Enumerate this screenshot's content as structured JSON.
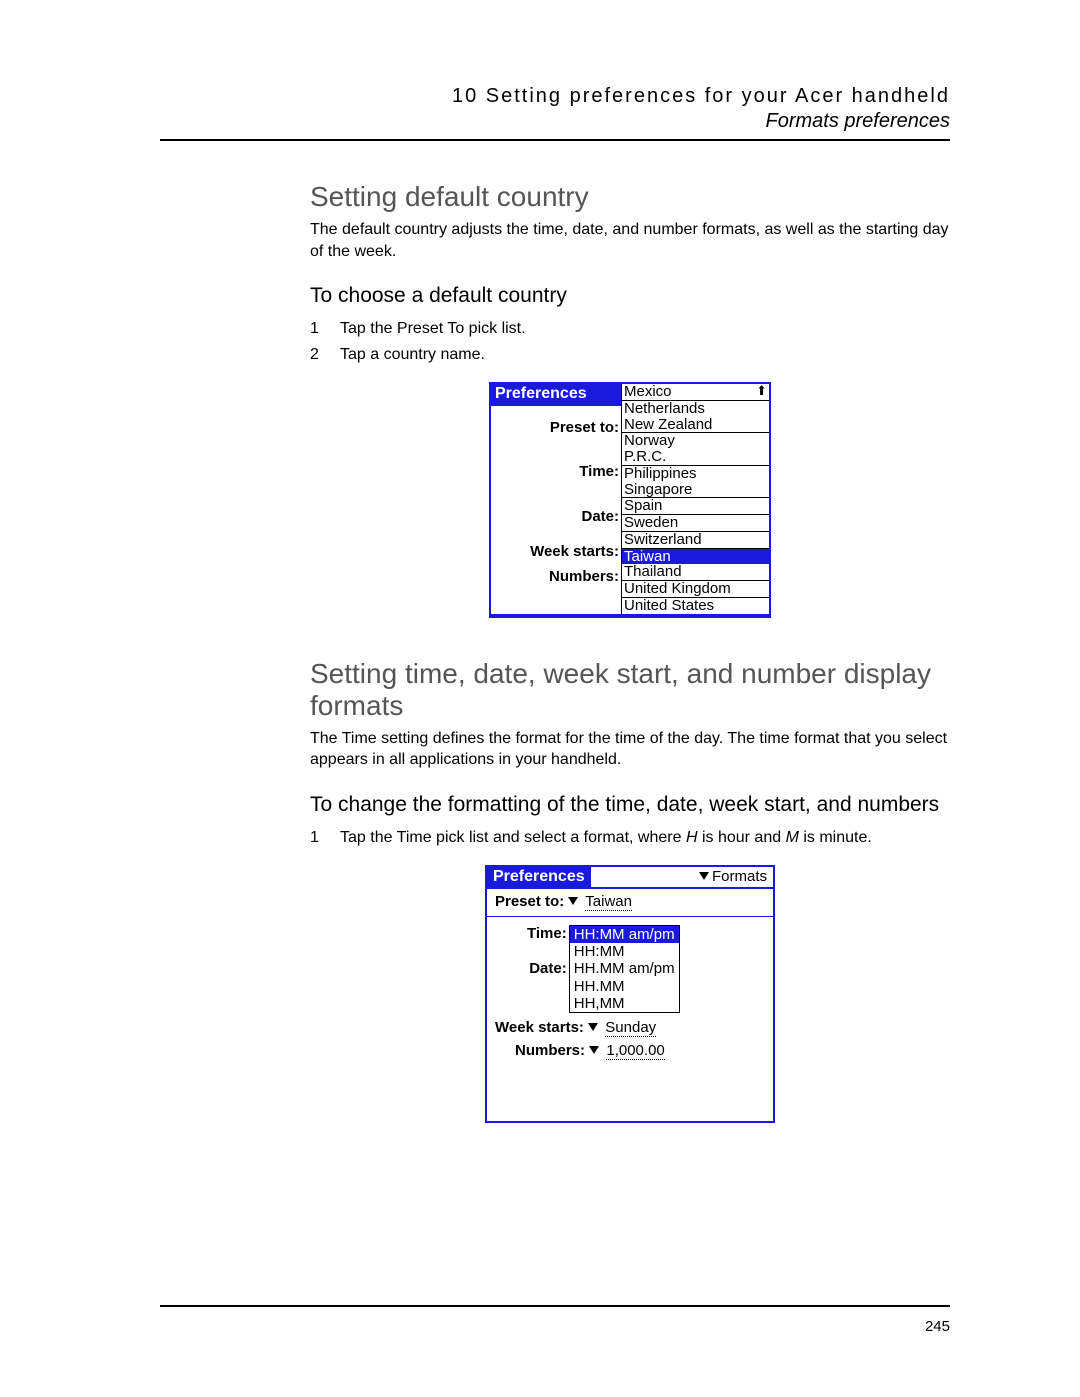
{
  "header": {
    "chapter": "10 Setting preferences for your Acer handheld",
    "section": "Formats preferences"
  },
  "section1": {
    "title": "Setting default country",
    "para": "The default country adjusts the time, date, and number formats, as well as the starting day of the week.",
    "subtitle": "To choose a default country",
    "steps": [
      "Tap the Preset To pick list.",
      "Tap a country name."
    ]
  },
  "device1": {
    "title": "Preferences",
    "labels": [
      "Preset to:",
      "Time:",
      "Date:",
      "Week starts:",
      "Numbers:"
    ],
    "countries": [
      "Mexico",
      "Netherlands",
      "New Zealand",
      "Norway",
      "P.R.C.",
      "Philippines",
      "Singapore",
      "Spain",
      "Sweden",
      "Switzerland",
      "Taiwan",
      "Thailand",
      "United Kingdom",
      "United States"
    ],
    "selected": "Taiwan"
  },
  "section2": {
    "title": "Setting time, date, week start, and number display formats",
    "para": "The Time setting defines the format for the time of the day. The time format that you select appears in all applications in your handheld.",
    "subtitle": "To change the formatting of the time, date, week start, and numbers",
    "step": "Tap the Time pick list and select a format, where H is hour and M is minute.",
    "step_italic_h": "H",
    "step_italic_m": "M"
  },
  "device2": {
    "title": "Preferences",
    "menu": "Formats",
    "preset_label": "Preset to:",
    "preset_value": "Taiwan",
    "time_label": "Time:",
    "date_label": "Date:",
    "time_options": [
      "HH:MM am/pm",
      "HH:MM",
      "HH.MM am/pm",
      "HH.MM",
      "HH,MM"
    ],
    "time_selected": "HH:MM am/pm",
    "week_label": "Week starts:",
    "week_value": "Sunday",
    "numbers_label": "Numbers:",
    "numbers_value": "1,000.00"
  },
  "page_number": "245"
}
